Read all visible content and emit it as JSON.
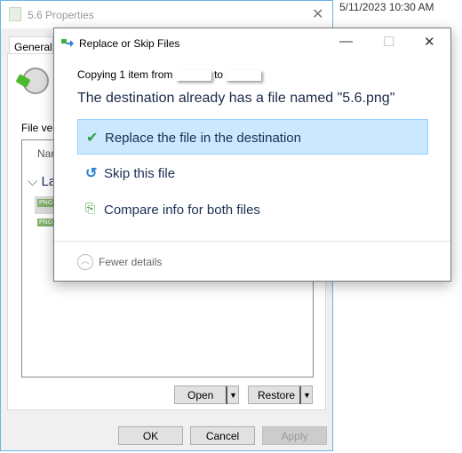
{
  "background": {
    "date_modified": "5/11/2023 10:30 AM"
  },
  "properties": {
    "title": "5.6 Properties",
    "tab": "General",
    "file_versions_label": "File vers",
    "list_header": "Nar",
    "group": "La",
    "file_icons": [
      "PNG",
      "PNG"
    ],
    "open_label": "Open",
    "restore_label": "Restore",
    "ok_label": "OK",
    "cancel_label": "Cancel",
    "apply_label": "Apply"
  },
  "dialog": {
    "title": "Replace or Skip Files",
    "copying_prefix": "Copying 1 item from",
    "copying_to": "to",
    "message": "The destination already has a file named \"5.6.png\"",
    "options": [
      {
        "label": "Replace the file in the destination",
        "icon": "checkmark-icon",
        "selected": true
      },
      {
        "label": "Skip this file",
        "icon": "skip-arrow-icon"
      },
      {
        "label": "Compare info for both files",
        "icon": "compare-icon"
      }
    ],
    "fewer_details": "Fewer details",
    "accent": "#cce8ff"
  }
}
